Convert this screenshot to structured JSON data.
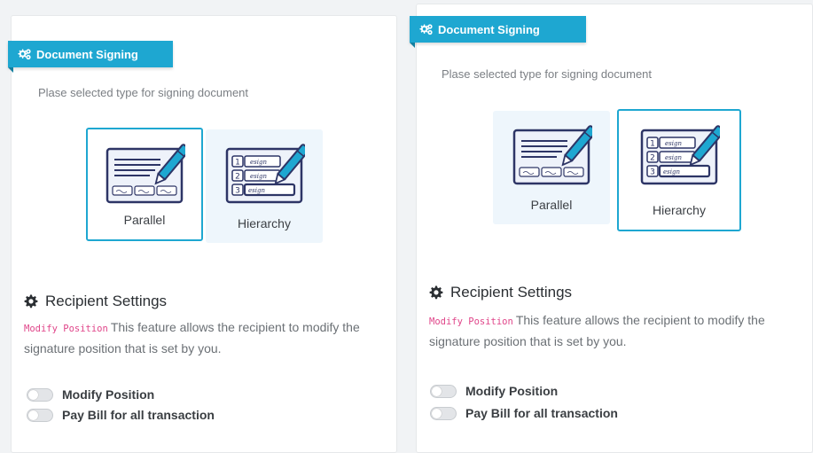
{
  "colors": {
    "accent": "#1ea7d1",
    "code_pink": "#e0468a",
    "selected_border": "#1ea7d1",
    "unselected_bg": "#eef6fc"
  },
  "panels": [
    {
      "header": {
        "title": "Document Signing",
        "icon": "cogs-icon"
      },
      "subtitle": "Plase selected type for signing document",
      "options": [
        {
          "label": "Parallel",
          "icon": "parallel-signing-illustration",
          "selected": true
        },
        {
          "label": "Hierarchy",
          "icon": "hierarchy-signing-illustration",
          "selected": false
        }
      ],
      "recipient": {
        "title": "Recipient Settings",
        "icon": "gear-icon",
        "code": "Modify Position",
        "description": "This feature allows the recipient to modify the signature position that is set by you."
      },
      "toggles": [
        {
          "label": "Modify Position",
          "on": false
        },
        {
          "label": "Pay Bill for all transaction",
          "on": false
        }
      ]
    },
    {
      "header": {
        "title": "Document Signing",
        "icon": "cogs-icon"
      },
      "subtitle": "Plase selected type for signing document",
      "options": [
        {
          "label": "Parallel",
          "icon": "parallel-signing-illustration",
          "selected": false
        },
        {
          "label": "Hierarchy",
          "icon": "hierarchy-signing-illustration",
          "selected": true
        }
      ],
      "recipient": {
        "title": "Recipient Settings",
        "icon": "gear-icon",
        "code": "Modify Position",
        "description": "This feature allows the recipient to modify the signature position that is set by you."
      },
      "toggles": [
        {
          "label": "Modify Position",
          "on": false
        },
        {
          "label": "Pay Bill for all transaction",
          "on": false
        }
      ]
    }
  ],
  "illustration_text": {
    "esign": "esign",
    "steps": [
      "1",
      "2",
      "3"
    ]
  }
}
